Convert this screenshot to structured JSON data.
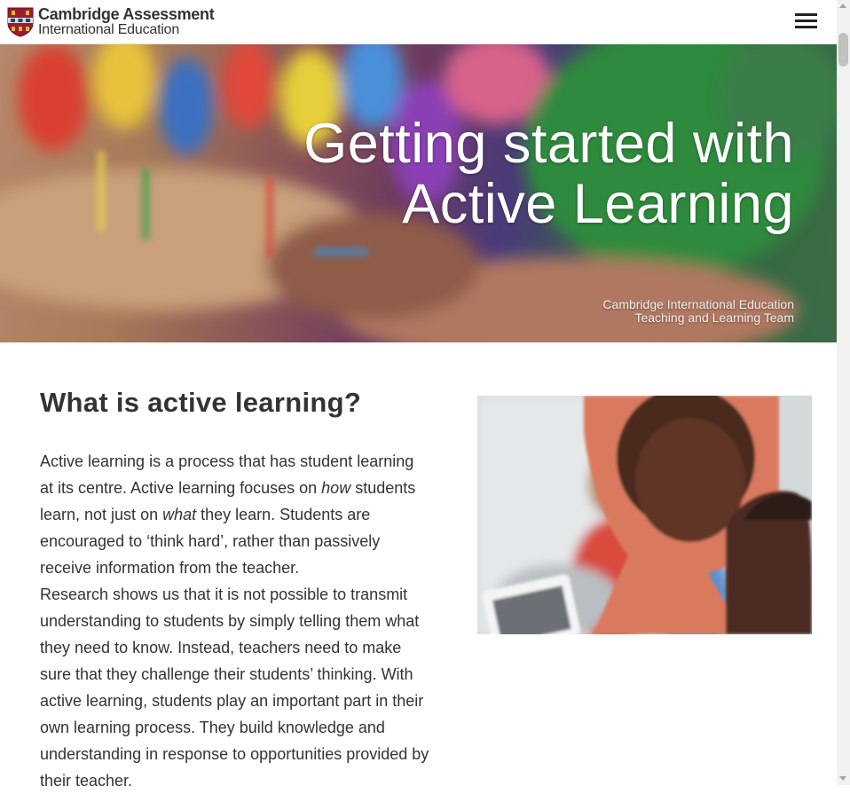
{
  "header": {
    "logo_line1": "Cambridge Assessment",
    "logo_line2": "International Education",
    "logo_icon": "crest-icon",
    "menu_icon": "hamburger-menu-icon"
  },
  "hero": {
    "title_line1": "Getting started with",
    "title_line2": "Active Learning",
    "credit_line1": "Cambridge International Education",
    "credit_line2": "Teaching and Learning Team"
  },
  "content": {
    "heading": "What is active learning?",
    "para1_part1": "Active learning is a process that has student learning at its centre. Active learning focuses on ",
    "para1_em1": "how",
    "para1_part2": " students learn, not just on ",
    "para1_em2": "what",
    "para1_part3": " they learn. Students are encouraged to ‘think hard’, rather than passively receive information from the teacher.",
    "para2": "Research shows us that it is not possible to transmit understanding to students by simply telling them what they need to know. Instead, teachers need to make sure that they challenge their students’ thinking. With active learning, students play an important part in their own learning process. They build knowledge and understanding in response to opportunities provided by their teacher."
  },
  "colors": {
    "brand_red": "#9b1c2e",
    "text": "#333333",
    "hero_text": "#ffffff"
  }
}
